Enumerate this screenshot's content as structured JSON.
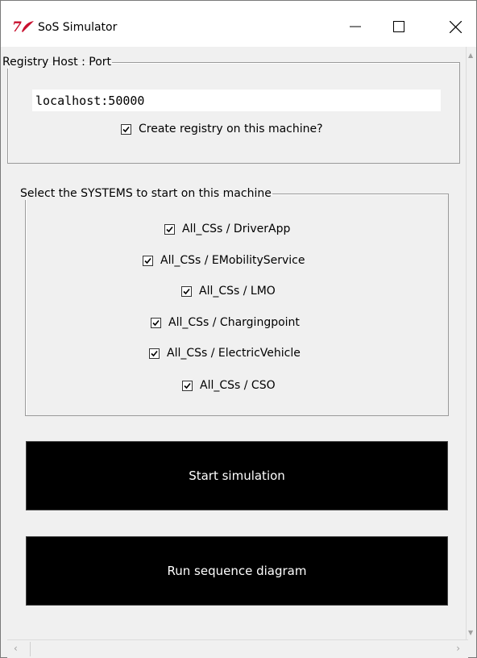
{
  "window": {
    "title": "SoS Simulator",
    "icon": "tk-feather-icon"
  },
  "registry": {
    "legend": "Registry Host : Port",
    "host_value": "localhost:50000",
    "create_label": "Create registry on this machine?",
    "create_checked": true
  },
  "systems": {
    "legend": "Select the SYSTEMS to start on this machine",
    "items": [
      {
        "label": "All_CSs / DriverApp",
        "checked": true
      },
      {
        "label": "All_CSs / EMobilityService",
        "checked": true
      },
      {
        "label": "All_CSs / LMO",
        "checked": true
      },
      {
        "label": "All_CSs / Chargingpoint",
        "checked": true
      },
      {
        "label": "All_CSs / ElectricVehicle",
        "checked": true
      },
      {
        "label": "All_CSs / CSO",
        "checked": true
      }
    ]
  },
  "buttons": {
    "start_label": "Start simulation",
    "sequence_label": "Run sequence diagram"
  }
}
